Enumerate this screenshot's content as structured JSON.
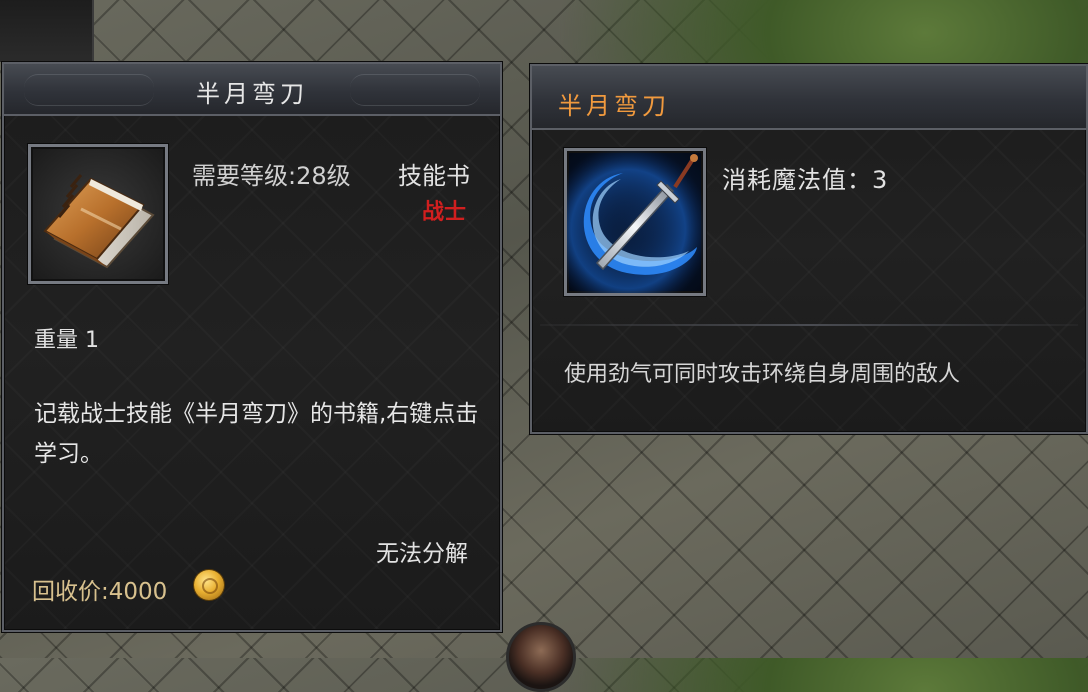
{
  "book_tooltip": {
    "title": "半月弯刀",
    "icon": "skill-book-icon",
    "level_requirement": "需要等级:28级",
    "item_type": "技能书",
    "class_requirement": "战士",
    "weight": "重量 1",
    "description": "记载战士技能《半月弯刀》的书籍,右键点击学习。",
    "dismantle": "无法分解",
    "recycle_price": "回收价:4000",
    "currency_icon": "gold-coin-icon"
  },
  "skill_tooltip": {
    "title": "半月弯刀",
    "icon": "crescent-sword-skill-icon",
    "mana_cost": "消耗魔法值：3",
    "description": "使用劲气可同时攻击环绕自身周围的敌人"
  },
  "colors": {
    "skill_title": "#f19a3e",
    "class_requirement": "#d11f1f",
    "panel_background": "#1e1e1e"
  }
}
